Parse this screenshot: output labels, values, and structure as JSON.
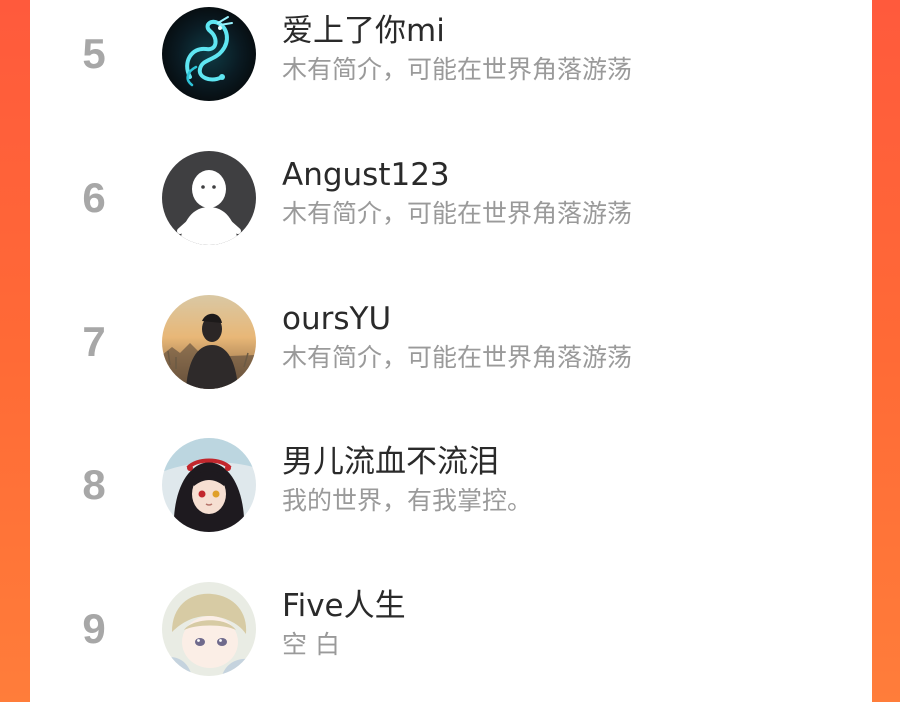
{
  "colors": {
    "accent_gradient_top": "#ff5a3c",
    "accent_gradient_bottom": "#ff7d3a",
    "card_background": "#ffffff",
    "rank_number": "#a7a7a7",
    "username": "#2a2a2a",
    "bio": "#9a9a9a"
  },
  "ranking": {
    "users": [
      {
        "rank": "5",
        "name": "爱上了你mi",
        "bio": "木有简介，可能在世界角落游荡",
        "avatar_icon": "dragon-avatar-icon"
      },
      {
        "rank": "6",
        "name": "Angust123",
        "bio": "木有简介，可能在世界角落游荡",
        "avatar_icon": "default-person-avatar-icon"
      },
      {
        "rank": "7",
        "name": "oursYU",
        "bio": "木有简介，可能在世界角落游荡",
        "avatar_icon": "sunset-portrait-avatar-icon"
      },
      {
        "rank": "8",
        "name": "男儿流血不流泪",
        "bio": "我的世界，有我掌控。",
        "avatar_icon": "anime-girl-avatar-icon"
      },
      {
        "rank": "9",
        "name": "Five人生",
        "bio": "空 白",
        "avatar_icon": "anime-boy-avatar-icon"
      }
    ]
  }
}
